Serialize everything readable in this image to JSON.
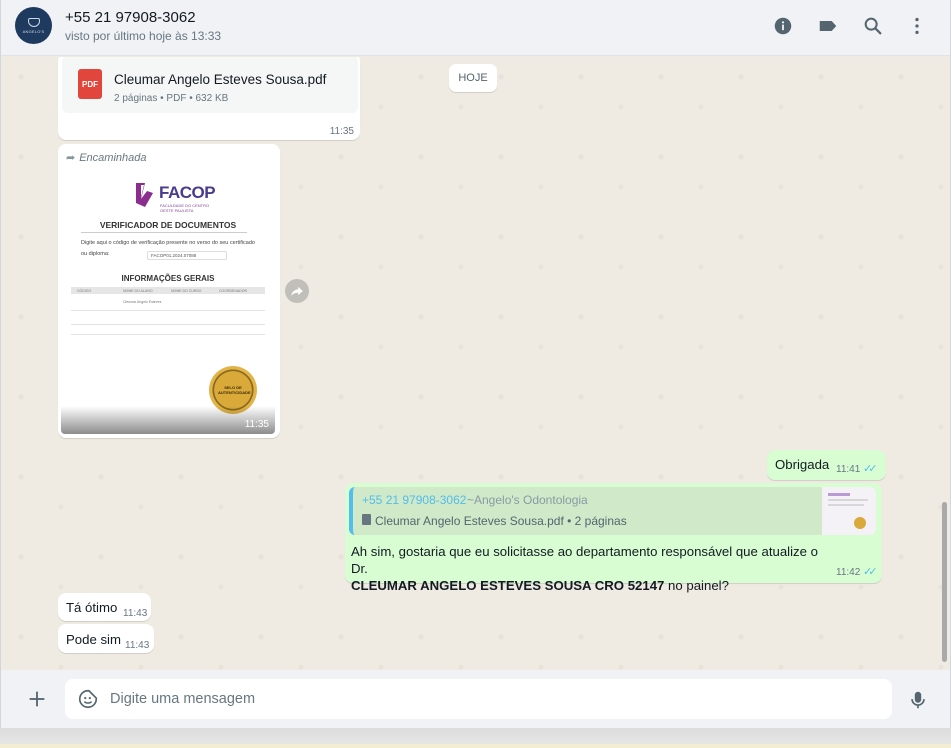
{
  "header": {
    "avatar_text": "ANGELO'S",
    "contact_name": "+55 21 97908-3062",
    "status": "visto por último hoje às 13:33"
  },
  "chat": {
    "date_chip": "HOJE",
    "pdf_message": {
      "filename": "Cleumar Angelo Esteves Sousa.pdf",
      "meta": "2 páginas • PDF • 632 KB",
      "badge": "PDF",
      "time": "11:35"
    },
    "image_message": {
      "forwarded_label": "Encaminhada",
      "time": "11:35",
      "doc": {
        "logo": "FACOP",
        "logo_sub": "FACULDADE DO CENTRO OESTE PAULISTA",
        "verifier_title": "VERIFICADOR DE DOCUMENTOS",
        "verifier_text": "Digite aqui o código de verificação presente no verso do seu certificado ou diploma:",
        "code": "FACOP01.2024.07088",
        "info_title": "INFORMAÇÕES GERAIS",
        "col_1": "CÓDIGO",
        "col_2": "NOME DO ALUNO",
        "col_3": "NOME DO CURSO",
        "col_4": "COORDENADOR",
        "row_student": "Cleumar Angelo Esteves",
        "seal_text": "SELO DE AUTENTICIDADE"
      }
    },
    "msg_obrigada": {
      "text": "Obrigada",
      "time": "11:41",
      "ticks": "✓✓"
    },
    "msg_reply": {
      "quote_sender": "+55 21 97908-3062",
      "quote_author": "~Angelo's Odontologia",
      "quote_doc": "Cleumar Angelo Esteves Sousa.pdf • 2 páginas",
      "text_before": "Ah sim, gostaria que eu solicitasse ao departamento responsável que atualize o Dr.",
      "text_bold": "CLEUMAR ANGELO ESTEVES SOUSA CRO 52147",
      "text_after": " no painel?",
      "time": "11:42",
      "ticks": "✓✓"
    },
    "msg_ta_otimo": {
      "text": "Tá ótimo",
      "time": "11:43"
    },
    "msg_pode_sim": {
      "text": "Pode sim",
      "time": "11:43"
    }
  },
  "composer": {
    "placeholder": "Digite uma mensagem"
  },
  "colors": {
    "outgoing_bubble": "#d9fdd3",
    "incoming_bubble": "#ffffff",
    "read_ticks": "#53bdeb",
    "chat_bg": "#efeae2",
    "header_bg": "#f0f2f5"
  }
}
